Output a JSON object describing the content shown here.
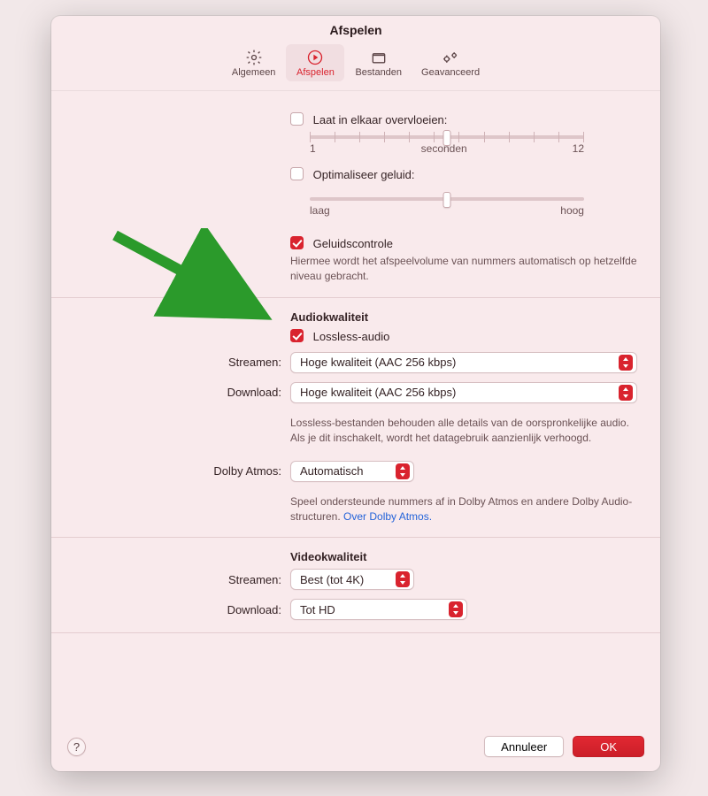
{
  "window_title": "Afspelen",
  "tabs": {
    "algemeen": "Algemeen",
    "afspelen": "Afspelen",
    "bestanden": "Bestanden",
    "geavanceerd": "Geavanceerd"
  },
  "crossfade": {
    "label": "Laat in elkaar overvloeien:",
    "min": "1",
    "unit": "seconden",
    "max": "12"
  },
  "optimize": {
    "label": "Optimaliseer geluid:",
    "low": "laag",
    "high": "hoog"
  },
  "soundcheck": {
    "label": "Geluidscontrole",
    "desc": "Hiermee wordt het afspeelvolume van nummers automatisch op hetzelfde niveau gebracht."
  },
  "audioquality": {
    "title": "Audiokwaliteit",
    "lossless_label": "Lossless-audio",
    "stream_label": "Streamen:",
    "stream_value": "Hoge kwaliteit (AAC 256 kbps)",
    "download_label": "Download:",
    "download_value": "Hoge kwaliteit (AAC 256 kbps)",
    "desc": "Lossless-bestanden behouden alle details van de oorspronkelijke audio. Als je dit inschakelt, wordt het datagebruik aanzienlijk verhoogd."
  },
  "dolby": {
    "label": "Dolby Atmos:",
    "value": "Automatisch",
    "desc_pre": "Speel ondersteunde nummers af in Dolby Atmos en andere Dolby Audio-structuren. ",
    "link": "Over Dolby Atmos."
  },
  "videoquality": {
    "title": "Videokwaliteit",
    "stream_label": "Streamen:",
    "stream_value": "Best (tot 4K)",
    "download_label": "Download:",
    "download_value": "Tot HD"
  },
  "footer": {
    "cancel": "Annuleer",
    "ok": "OK"
  }
}
